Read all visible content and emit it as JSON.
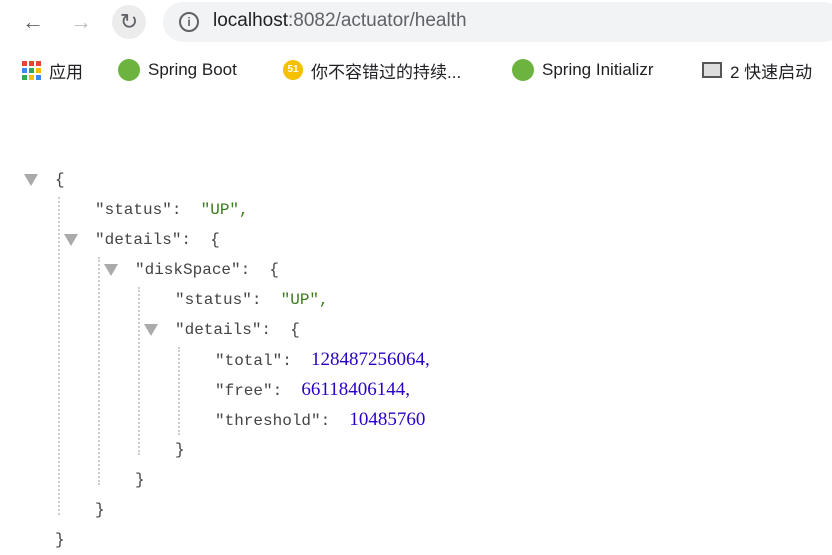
{
  "browser": {
    "url_host": "localhost",
    "url_rest": ":8082/actuator/health"
  },
  "bookmarks": [
    {
      "label": "应用",
      "icon": "apps-grid-icon"
    },
    {
      "label": "Spring Boot",
      "icon": "spring-leaf-icon"
    },
    {
      "label": "你不容错过的持续...",
      "icon": "51-badge-icon"
    },
    {
      "label": "Spring Initializr",
      "icon": "spring-leaf-icon"
    },
    {
      "label": "2 快速启动",
      "icon": "book-icon"
    }
  ],
  "json": {
    "open": "{",
    "close": "}",
    "status_key": "\"status\":",
    "status_val": "\"UP\",",
    "details_key": "\"details\":",
    "disk_key": "\"diskSpace\":",
    "disk_status_key": "\"status\":",
    "disk_status_val": "\"UP\",",
    "disk_details_key": "\"details\":",
    "total_key": "\"total\":",
    "total_val": "128487256064,",
    "free_key": "\"free\":",
    "free_val": "66118406144,",
    "threshold_key": "\"threshold\":",
    "threshold_val": "10485760"
  },
  "colors": {
    "string": "#3a7a1a",
    "number": "#2a00c8",
    "key": "#444444"
  }
}
